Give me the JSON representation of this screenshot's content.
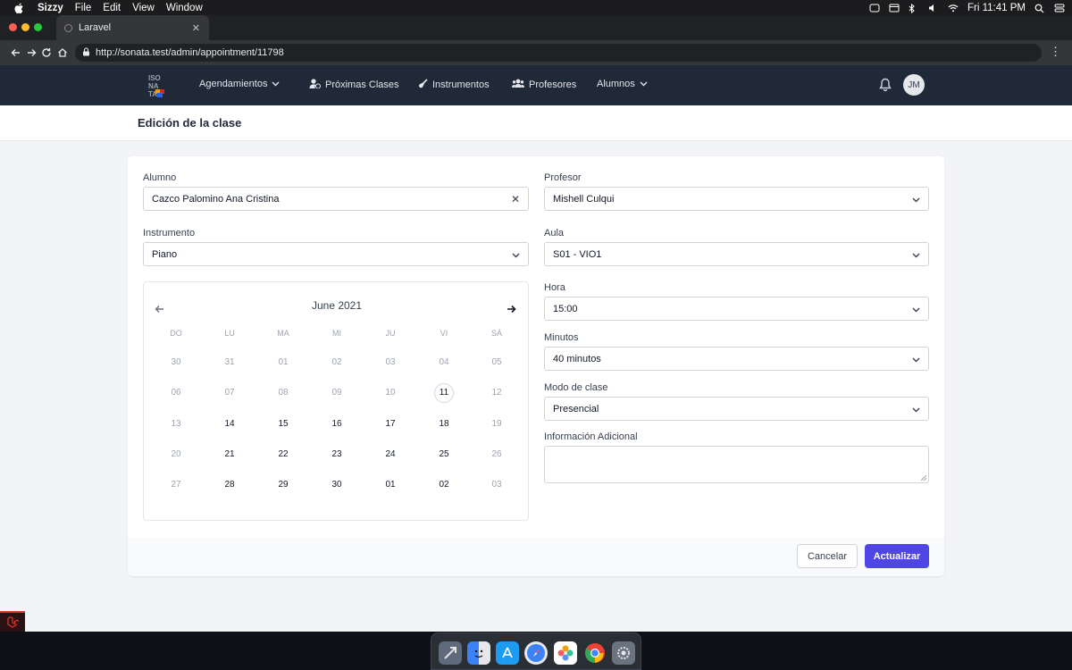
{
  "menubar": {
    "app_name": "Sizzy",
    "items": [
      "File",
      "Edit",
      "View",
      "Window"
    ],
    "clock": "Fri 11:41 PM"
  },
  "browser": {
    "tab_title": "Laravel",
    "url": "http://sonata.test/admin/appointment/11798"
  },
  "nav": {
    "items": [
      {
        "label": "Agendamientos"
      },
      {
        "label": "Próximas Clases"
      },
      {
        "label": "Instrumentos"
      },
      {
        "label": "Profesores"
      },
      {
        "label": "Alumnos"
      }
    ],
    "avatar_initials": "JM"
  },
  "page": {
    "title": "Edición de la clase"
  },
  "form": {
    "alumno": {
      "label": "Alumno",
      "value": "Cazco Palomino Ana Cristina"
    },
    "instrumento": {
      "label": "Instrumento",
      "value": "Piano"
    },
    "profesor": {
      "label": "Profesor",
      "value": "Mishell Culqui"
    },
    "aula": {
      "label": "Aula",
      "value": "S01 - VIO1"
    },
    "hora": {
      "label": "Hora",
      "value": "15:00"
    },
    "minutos": {
      "label": "Minutos",
      "value": "40 minutos"
    },
    "modo": {
      "label": "Modo de clase",
      "value": "Presencial"
    },
    "info": {
      "label": "Información Adicional",
      "value": ""
    }
  },
  "calendar": {
    "month": "June 2021",
    "weekdays": [
      "DO",
      "LU",
      "MA",
      "MI",
      "JU",
      "VI",
      "SÁ"
    ],
    "weeks": [
      [
        {
          "d": "30",
          "m": true
        },
        {
          "d": "31",
          "m": true
        },
        {
          "d": "01",
          "m": true
        },
        {
          "d": "02",
          "m": true
        },
        {
          "d": "03",
          "m": true
        },
        {
          "d": "04",
          "m": true
        },
        {
          "d": "05",
          "m": true
        }
      ],
      [
        {
          "d": "06",
          "m": true
        },
        {
          "d": "07",
          "m": true
        },
        {
          "d": "08",
          "m": true
        },
        {
          "d": "09",
          "m": true
        },
        {
          "d": "10",
          "m": true
        },
        {
          "d": "11",
          "m": false,
          "today": true
        },
        {
          "d": "12",
          "m": true
        }
      ],
      [
        {
          "d": "13",
          "m": true
        },
        {
          "d": "14",
          "m": false
        },
        {
          "d": "15",
          "m": false
        },
        {
          "d": "16",
          "m": false
        },
        {
          "d": "17",
          "m": false
        },
        {
          "d": "18",
          "m": false
        },
        {
          "d": "19",
          "m": true
        }
      ],
      [
        {
          "d": "20",
          "m": true
        },
        {
          "d": "21",
          "m": false
        },
        {
          "d": "22",
          "m": false
        },
        {
          "d": "23",
          "m": false
        },
        {
          "d": "24",
          "m": false
        },
        {
          "d": "25",
          "m": false
        },
        {
          "d": "26",
          "m": true
        }
      ],
      [
        {
          "d": "27",
          "m": true
        },
        {
          "d": "28",
          "m": false
        },
        {
          "d": "29",
          "m": false
        },
        {
          "d": "30",
          "m": false
        },
        {
          "d": "01",
          "m": false
        },
        {
          "d": "02",
          "m": false
        },
        {
          "d": "03",
          "m": true
        }
      ]
    ]
  },
  "buttons": {
    "cancel": "Cancelar",
    "update": "Actualizar"
  },
  "colors": {
    "primary": "#4f46e5",
    "nav_bg": "#1f2937"
  }
}
